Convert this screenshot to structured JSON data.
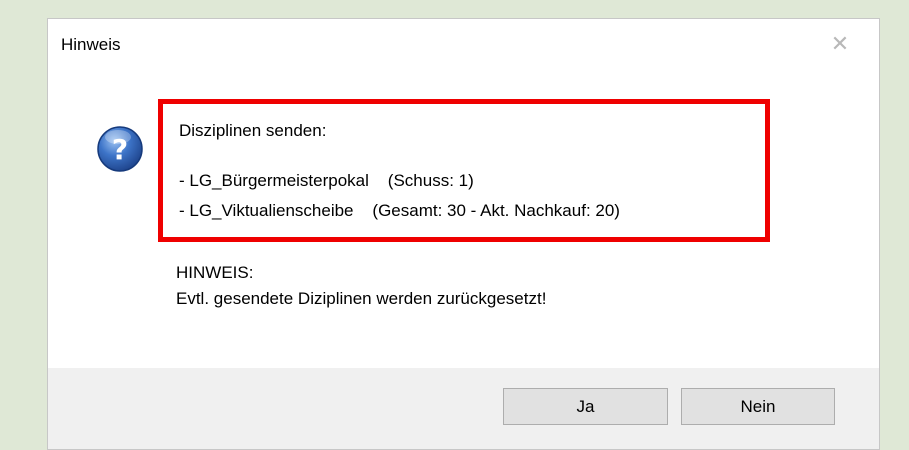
{
  "dialog": {
    "title": "Hinweis",
    "close_glyph": "✕",
    "icon": "question-icon",
    "highlight_color": "#ef0000",
    "message": {
      "heading": "Disziplinen senden:",
      "line1": "- LG_Bürgermeisterpokal    (Schuss: 1)",
      "line2": "- LG_Viktualienscheibe    (Gesamt: 30 - Akt. Nachkauf: 20)"
    },
    "note": {
      "heading": "HINWEIS:",
      "text": "Evtl. gesendete Diziplinen werden zurückgesetzt!"
    },
    "buttons": {
      "yes": "Ja",
      "no": "Nein"
    }
  }
}
